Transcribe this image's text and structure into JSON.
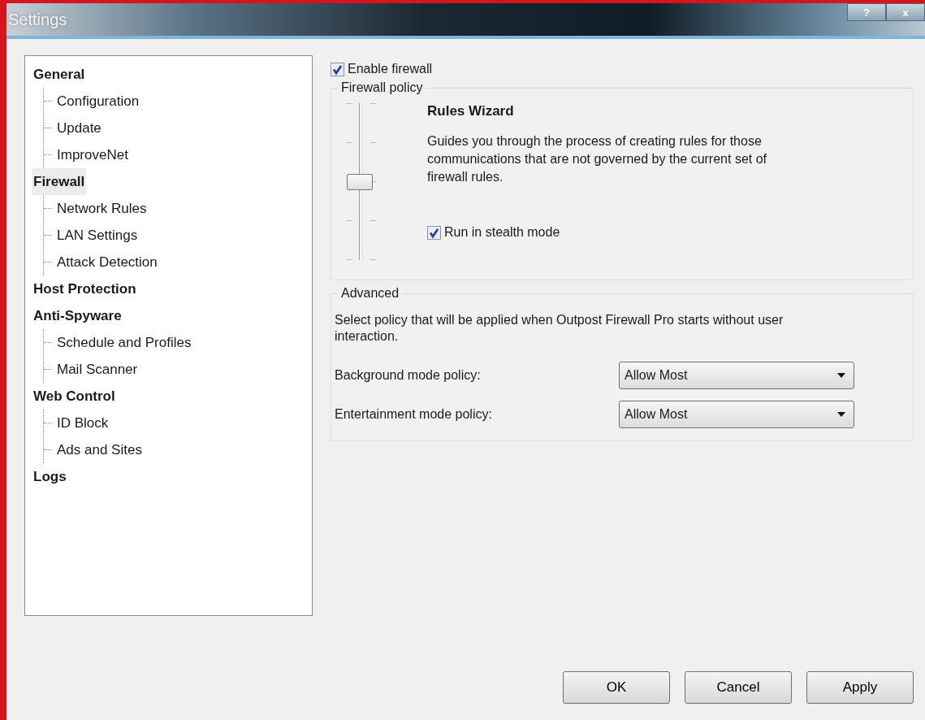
{
  "window": {
    "title": "Settings",
    "help_button": "?",
    "close_button": "x"
  },
  "tree": [
    {
      "label": "General",
      "selected": false,
      "children": [
        {
          "label": "Configuration",
          "selected": false
        },
        {
          "label": "Update",
          "selected": false
        },
        {
          "label": "ImproveNet",
          "selected": false
        }
      ]
    },
    {
      "label": "Firewall",
      "selected": true,
      "children": [
        {
          "label": "Network Rules",
          "selected": false
        },
        {
          "label": "LAN Settings",
          "selected": false
        },
        {
          "label": "Attack Detection",
          "selected": false
        }
      ]
    },
    {
      "label": "Host Protection",
      "selected": false
    },
    {
      "label": "Anti-Spyware",
      "selected": false,
      "children": [
        {
          "label": "Schedule and Profiles",
          "selected": false
        },
        {
          "label": "Mail Scanner",
          "selected": false
        }
      ]
    },
    {
      "label": "Web Control",
      "selected": false,
      "children": [
        {
          "label": "ID Block",
          "selected": false
        },
        {
          "label": "Ads and Sites",
          "selected": false
        }
      ]
    },
    {
      "label": "Logs",
      "selected": false
    }
  ],
  "enable_firewall": {
    "label": "Enable firewall",
    "checked": true
  },
  "firewall_policy": {
    "title": "Firewall policy",
    "slider": {
      "level": 0.5
    },
    "policy_name": "Rules Wizard",
    "description": "Guides you through the process of creating rules for those communications that are not governed by the current set of firewall rules.",
    "stealth": {
      "label": "Run in stealth mode",
      "checked": true
    }
  },
  "advanced": {
    "title": "Advanced",
    "description": "Select policy that will be applied when Outpost Firewall Pro starts without user interaction.",
    "policies": [
      {
        "label": "Background mode policy:",
        "value": "Allow Most"
      },
      {
        "label": "Entertainment mode policy:",
        "value": "Allow Most"
      }
    ]
  },
  "buttons": [
    "OK",
    "Cancel",
    "Apply"
  ]
}
